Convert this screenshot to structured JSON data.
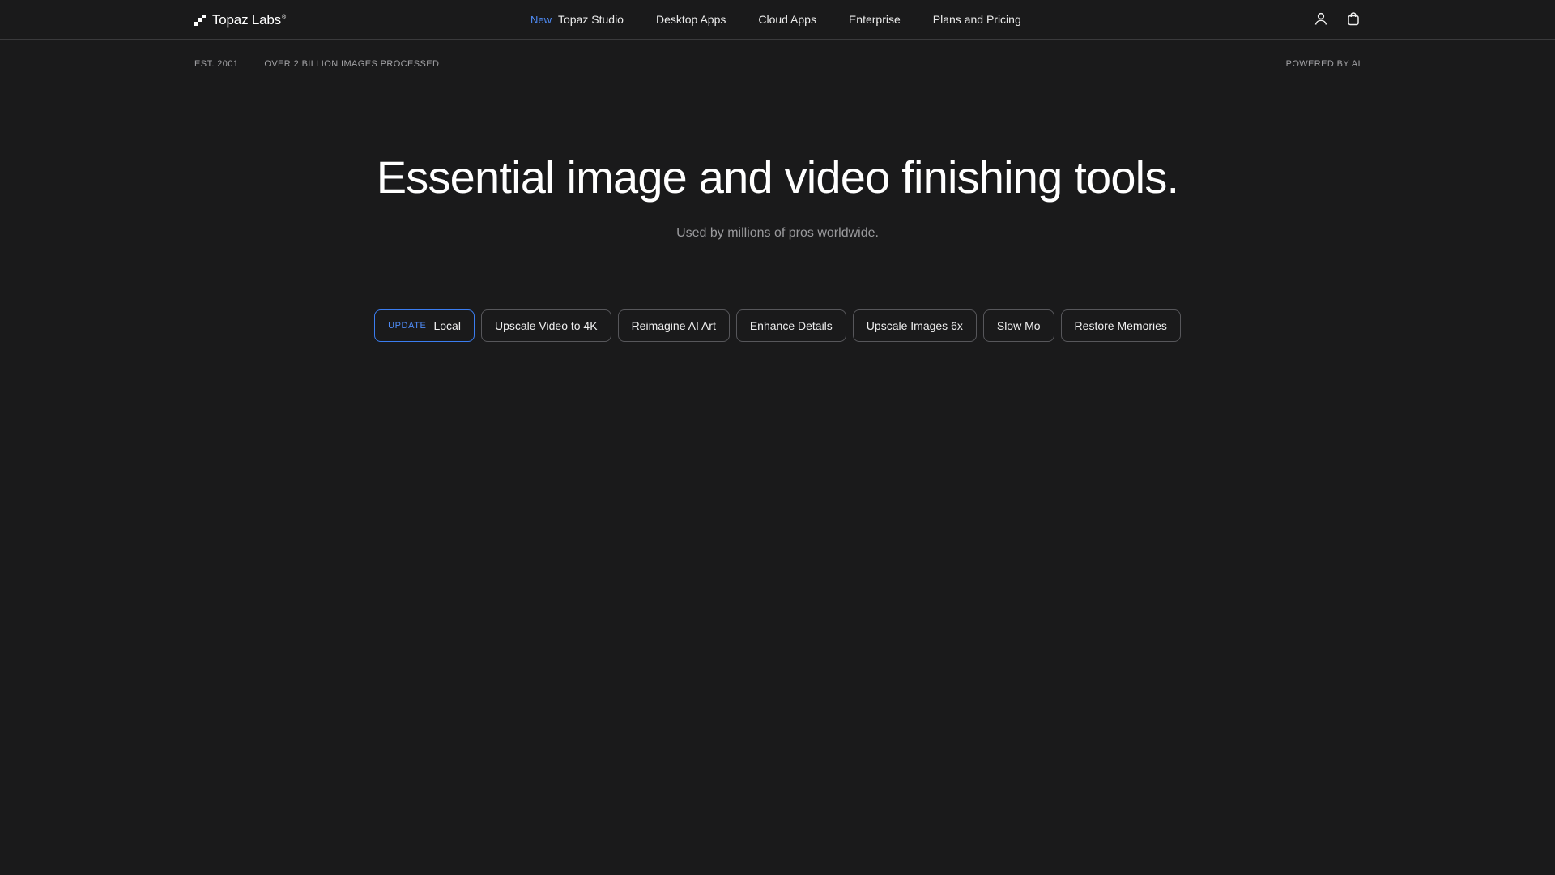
{
  "brand": {
    "name": "Topaz Labs",
    "mark": "®"
  },
  "nav": {
    "new_badge": "New",
    "items": [
      {
        "label": "Topaz Studio"
      },
      {
        "label": "Desktop Apps"
      },
      {
        "label": "Cloud Apps"
      },
      {
        "label": "Enterprise"
      },
      {
        "label": "Plans and Pricing"
      }
    ],
    "icons": [
      "user-icon",
      "shopping-bag-icon"
    ]
  },
  "subbar": {
    "est": "EST. 2001",
    "processed": "OVER 2 BILLION IMAGES PROCESSED",
    "powered": "POWERED BY AI"
  },
  "hero": {
    "title": "Essential image and video finishing tools.",
    "subtitle": "Used by millions of pros worldwide."
  },
  "chips": {
    "update_badge": "UPDATE",
    "items": [
      {
        "label": "Local"
      },
      {
        "label": "Upscale Video to 4K"
      },
      {
        "label": "Reimagine AI Art"
      },
      {
        "label": "Enhance Details"
      },
      {
        "label": "Upscale Images 6x"
      },
      {
        "label": "Slow Mo"
      },
      {
        "label": "Restore Memories"
      }
    ]
  },
  "colors": {
    "background": "#1a1a1b",
    "accent": "#4f8cf7",
    "active_border": "#3b7df0"
  }
}
